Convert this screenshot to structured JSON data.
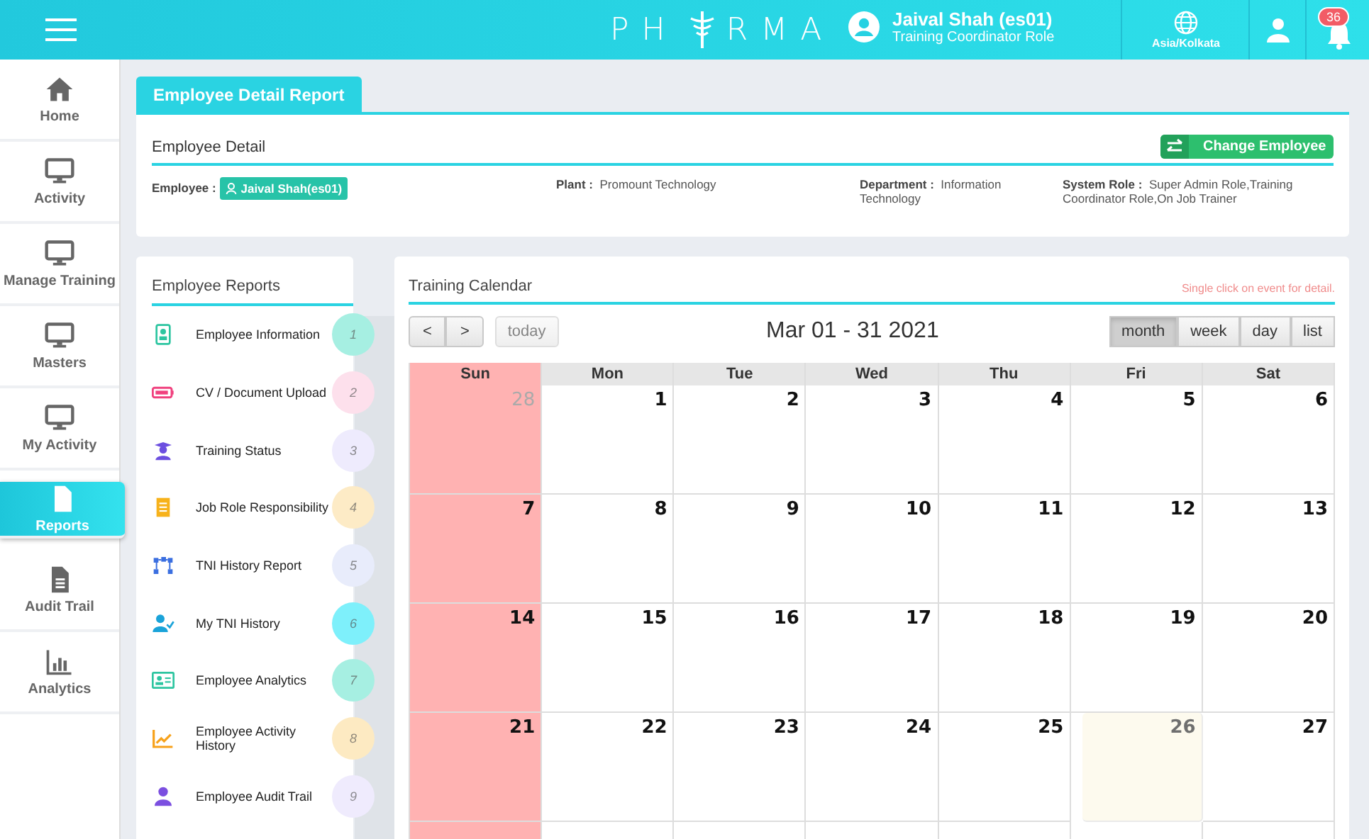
{
  "header": {
    "logo": {
      "left": "PH",
      "right": "RMA"
    },
    "user": {
      "name": "Jaival Shah (es01)",
      "role": "Training Coordinator Role"
    },
    "timezone": "Asia/Kolkata",
    "notifications": "36"
  },
  "sidebar": {
    "items": [
      {
        "label": "Home",
        "selected": false
      },
      {
        "label": "Activity",
        "selected": false
      },
      {
        "label": "Manage Training",
        "selected": false
      },
      {
        "label": "Masters",
        "selected": false
      },
      {
        "label": "My Activity",
        "selected": false
      },
      {
        "label": "Reports",
        "selected": true
      },
      {
        "label": "Audit Trail",
        "selected": false
      },
      {
        "label": "Analytics",
        "selected": false
      }
    ]
  },
  "page_tab": "Employee Detail Report",
  "employee_detail": {
    "title": "Employee Detail",
    "button": "Change Employee",
    "fields": [
      {
        "label": "Employee :",
        "value": "Jaival Shah(es01)",
        "kind": "badge"
      },
      {
        "label": "Plant :",
        "value": "Promount Technology",
        "kind": "text"
      },
      {
        "label": "Department :",
        "value": "Information Technology",
        "kind": "text"
      },
      {
        "label": "System Role :",
        "value": "Super Admin Role,Training Coordinator Role,On Job Trainer",
        "kind": "text"
      }
    ]
  },
  "employee_reports": {
    "title": "Employee Reports",
    "items": [
      {
        "label": "Employee Information",
        "number": "1",
        "color": "#a6efe2"
      },
      {
        "label": "CV / Document Upload",
        "number": "2",
        "color": "#fde0ec"
      },
      {
        "label": "Training Status",
        "number": "3",
        "color": "#eeebfd"
      },
      {
        "label": "Job Role Responsibility",
        "number": "4",
        "color": "#fdebc6"
      },
      {
        "label": "TNI History Report",
        "number": "5",
        "color": "#e8ecfb"
      },
      {
        "label": "My TNI History",
        "number": "6",
        "color": "#7ef0fb"
      },
      {
        "label": "Employee Analytics",
        "number": "7",
        "color": "#a6efe2"
      },
      {
        "label": "Employee Activity History",
        "number": "8",
        "color": "#fdeac2"
      },
      {
        "label": "Employee Audit Trail",
        "number": "9",
        "color": "#efebfd"
      }
    ]
  },
  "calendar": {
    "title": "Training Calendar",
    "hint": "Single click on event for detail.",
    "prev": "<",
    "next": ">",
    "today_button": "today",
    "range": "Mar 01 - 31 2021",
    "views": [
      {
        "label": "month",
        "selected": true
      },
      {
        "label": "week",
        "selected": false
      },
      {
        "label": "day",
        "selected": false
      },
      {
        "label": "list",
        "selected": false
      }
    ],
    "columns": [
      {
        "label": "Sun",
        "weekend": true
      },
      {
        "label": "Mon",
        "weekend": false
      },
      {
        "label": "Tue",
        "weekend": false
      },
      {
        "label": "Wed",
        "weekend": false
      },
      {
        "label": "Thu",
        "weekend": false
      },
      {
        "label": "Fri",
        "weekend": false
      },
      {
        "label": "Sat",
        "weekend": false
      }
    ],
    "weeks": [
      [
        {
          "day": "28",
          "muted": true,
          "today": false
        },
        {
          "day": "1",
          "muted": false,
          "today": false
        },
        {
          "day": "2",
          "muted": false,
          "today": false
        },
        {
          "day": "3",
          "muted": false,
          "today": false
        },
        {
          "day": "4",
          "muted": false,
          "today": false
        },
        {
          "day": "5",
          "muted": false,
          "today": false
        },
        {
          "day": "6",
          "muted": false,
          "today": false
        }
      ],
      [
        {
          "day": "7",
          "muted": false,
          "today": false
        },
        {
          "day": "8",
          "muted": false,
          "today": false
        },
        {
          "day": "9",
          "muted": false,
          "today": false
        },
        {
          "day": "10",
          "muted": false,
          "today": false
        },
        {
          "day": "11",
          "muted": false,
          "today": false
        },
        {
          "day": "12",
          "muted": false,
          "today": false
        },
        {
          "day": "13",
          "muted": false,
          "today": false
        }
      ],
      [
        {
          "day": "14",
          "muted": false,
          "today": false
        },
        {
          "day": "15",
          "muted": false,
          "today": false
        },
        {
          "day": "16",
          "muted": false,
          "today": false
        },
        {
          "day": "17",
          "muted": false,
          "today": false
        },
        {
          "day": "18",
          "muted": false,
          "today": false
        },
        {
          "day": "19",
          "muted": false,
          "today": false
        },
        {
          "day": "20",
          "muted": false,
          "today": false
        }
      ],
      [
        {
          "day": "21",
          "muted": false,
          "today": false
        },
        {
          "day": "22",
          "muted": false,
          "today": false
        },
        {
          "day": "23",
          "muted": false,
          "today": false
        },
        {
          "day": "24",
          "muted": false,
          "today": false
        },
        {
          "day": "25",
          "muted": false,
          "today": false
        },
        {
          "day": "26",
          "muted": false,
          "today": true
        },
        {
          "day": "27",
          "muted": false,
          "today": false
        }
      ]
    ]
  }
}
